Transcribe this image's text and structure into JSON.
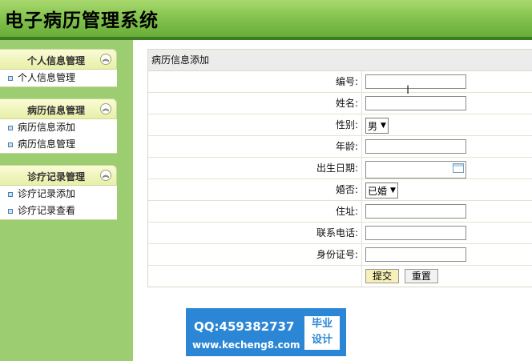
{
  "app": {
    "title": "电子病历管理系统"
  },
  "sidebar": {
    "groups": [
      {
        "label": "个人信息管理",
        "items": [
          {
            "label": "个人信息管理"
          }
        ]
      },
      {
        "label": "病历信息管理",
        "items": [
          {
            "label": "病历信息添加"
          },
          {
            "label": "病历信息管理"
          }
        ]
      },
      {
        "label": "诊疗记录管理",
        "items": [
          {
            "label": "诊疗记录添加"
          },
          {
            "label": "诊疗记录查看"
          }
        ]
      }
    ],
    "collapse_icon": "double-chevron-up-icon"
  },
  "form": {
    "title": "病历信息添加",
    "fields": [
      {
        "label": "编号:",
        "type": "text",
        "value": ""
      },
      {
        "label": "姓名:",
        "type": "text",
        "value": ""
      },
      {
        "label": "性别:",
        "type": "select",
        "value": "男"
      },
      {
        "label": "年龄:",
        "type": "text",
        "value": ""
      },
      {
        "label": "出生日期:",
        "type": "date",
        "value": ""
      },
      {
        "label": "婚否:",
        "type": "select",
        "value": "已婚"
      },
      {
        "label": "住址:",
        "type": "text",
        "value": ""
      },
      {
        "label": "联系电话:",
        "type": "text",
        "value": ""
      },
      {
        "label": "身份证号:",
        "type": "text",
        "value": ""
      }
    ],
    "submit_label": "提交",
    "reset_label": "重置"
  },
  "watermark": {
    "qq": "QQ:459382737",
    "site": "www.kecheng8.com",
    "badge_line1": "毕业",
    "badge_line2": "设计"
  },
  "colors": {
    "header_green": "#7fc04a",
    "sidebar_green": "#9ccd70",
    "watermark_blue": "#2b87d6"
  }
}
